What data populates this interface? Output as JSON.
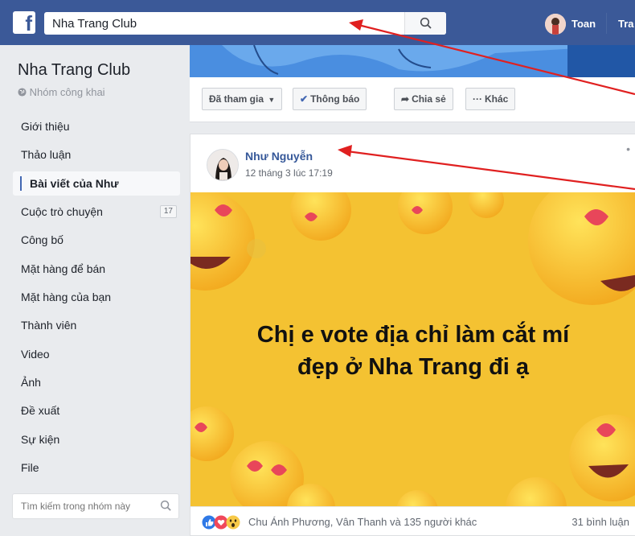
{
  "topbar": {
    "logo": "f",
    "search_value": "Nha Trang Club",
    "user_name": "Toan",
    "next_link": "Tra",
    "icons": [
      "facebook-logo",
      "search-icon",
      "avatar"
    ]
  },
  "sidebar": {
    "group_name": "Nha Trang Club",
    "group_type": "Nhóm công khai",
    "items": [
      {
        "label": "Giới thiệu"
      },
      {
        "label": "Thảo luận"
      },
      {
        "label": "Bài viết của Như"
      },
      {
        "label": "Cuộc trò chuyện",
        "badge": "17"
      },
      {
        "label": "Công bố"
      },
      {
        "label": "Mặt hàng để bán"
      },
      {
        "label": "Mặt hàng của bạn"
      },
      {
        "label": "Thành viên"
      },
      {
        "label": "Video"
      },
      {
        "label": "Ảnh"
      },
      {
        "label": "Đề xuất"
      },
      {
        "label": "Sự kiện"
      },
      {
        "label": "File"
      }
    ],
    "search_placeholder": "Tìm kiếm trong nhóm này"
  },
  "actions": {
    "joined": "Đã tham gia",
    "notify": "Thông báo",
    "share": "Chia sẻ",
    "more": "Khác"
  },
  "post": {
    "author": "Như Nguyễn",
    "time": "12 tháng 3 lúc 17:19",
    "caption_line1": "Chị e vote địa chỉ làm cắt mí",
    "caption_line2": "đẹp ở Nha Trang đi ạ",
    "reactions_text": "Chu Ánh Phương, Vân Thanh và 135 người khác",
    "comments": "31 bình luận",
    "reaction_icons": [
      "like-icon",
      "love-icon",
      "wow-icon"
    ]
  },
  "colors": {
    "facebook_blue": "#3b5998",
    "link_blue": "#365899",
    "post_bg_yellow": "#f4c12f",
    "arrow_red": "#e02020"
  }
}
